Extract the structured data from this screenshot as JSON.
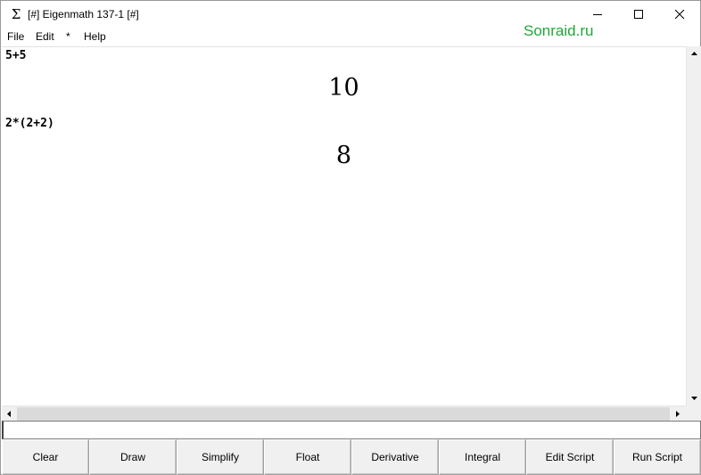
{
  "window": {
    "title": "[#] Eigenmath 137-1 [#]",
    "icon": "sigma-icon",
    "icon_glyph": "Σ"
  },
  "menu": {
    "items": [
      "File",
      "Edit",
      "*",
      "Help"
    ]
  },
  "watermark": "Sonraid.ru",
  "output": {
    "entries": [
      {
        "input": "5+5",
        "result": "10"
      },
      {
        "input": "2*(2+2)",
        "result": "8"
      }
    ]
  },
  "command_input": {
    "value": ""
  },
  "buttons": [
    "Clear",
    "Draw",
    "Simplify",
    "Float",
    "Derivative",
    "Integral",
    "Edit Script",
    "Run Script"
  ],
  "colors": {
    "watermark": "#1fa83a",
    "button_face": "#f0f0f0"
  }
}
